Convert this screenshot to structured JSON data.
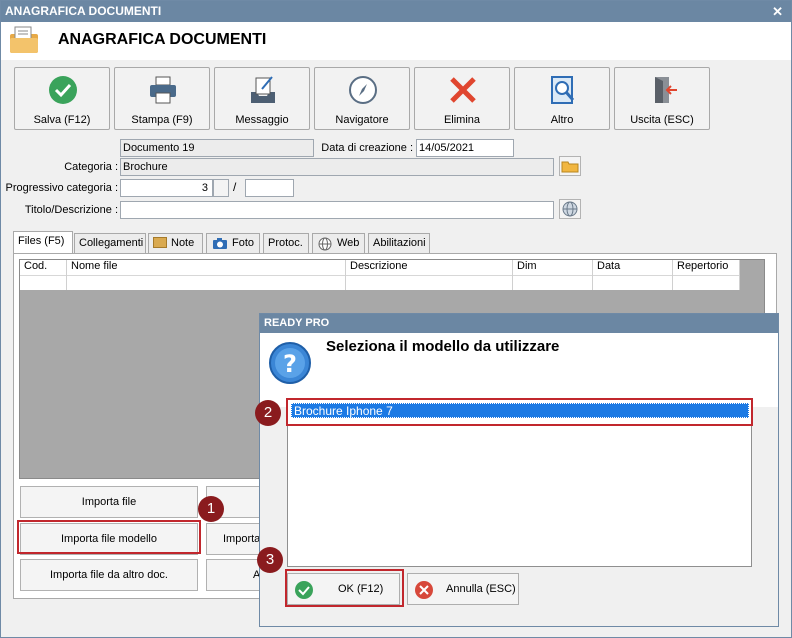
{
  "window": {
    "title": "ANAGRAFICA DOCUMENTI",
    "close_glyph": "✕",
    "header_title": "ANAGRAFICA DOCUMENTI"
  },
  "toolbar": [
    {
      "label": "Salva (F12)",
      "icon": "check-icon"
    },
    {
      "label": "Stampa (F9)",
      "icon": "printer-icon"
    },
    {
      "label": "Messaggio",
      "icon": "message-icon"
    },
    {
      "label": "Navigatore",
      "icon": "compass-icon"
    },
    {
      "label": "Elimina",
      "icon": "delete-icon"
    },
    {
      "label": "Altro",
      "icon": "search-doc-icon"
    },
    {
      "label": "Uscita (ESC)",
      "icon": "exit-icon"
    }
  ],
  "form": {
    "document": "Documento 19",
    "date_label": "Data di creazione :",
    "date_value": "14/05/2021",
    "category_label": "Categoria :",
    "category_value": "Brochure",
    "progressive_label": "Progressivo categoria :",
    "progressive_value": "3",
    "progressive_sep": "/",
    "progressive_suffix": "",
    "title_label": "Titolo/Descrizione :",
    "title_value": ""
  },
  "tabs": [
    "Files (F5)",
    "Collegamenti",
    "Note",
    "Foto",
    "Protoc.",
    "Web",
    "Abilitazioni"
  ],
  "grid_columns": [
    "Cod.",
    "Nome file",
    "Descrizione",
    "Dim",
    "Data",
    "Repertorio"
  ],
  "buttons": {
    "import_file": "Importa file",
    "import_model": "Importa file modello",
    "import_model_other_partial": "Importa",
    "import_other_doc": "Importa file da altro doc.",
    "partial_a": "A"
  },
  "dialog": {
    "title": "READY PRO",
    "message": "Seleziona il modello da utilizzare",
    "items": [
      "Brochure Iphone 7"
    ],
    "ok_label": "OK (F12)",
    "cancel_label": "Annulla (ESC)"
  },
  "badges": [
    "1",
    "2",
    "3"
  ],
  "colors": {
    "titlebar": "#6b87a3",
    "highlight": "#1c7ae4",
    "callout": "#c1272d",
    "badge": "#8a1b1e",
    "ok_green": "#3aa35b",
    "cancel_red": "#d7483a"
  }
}
